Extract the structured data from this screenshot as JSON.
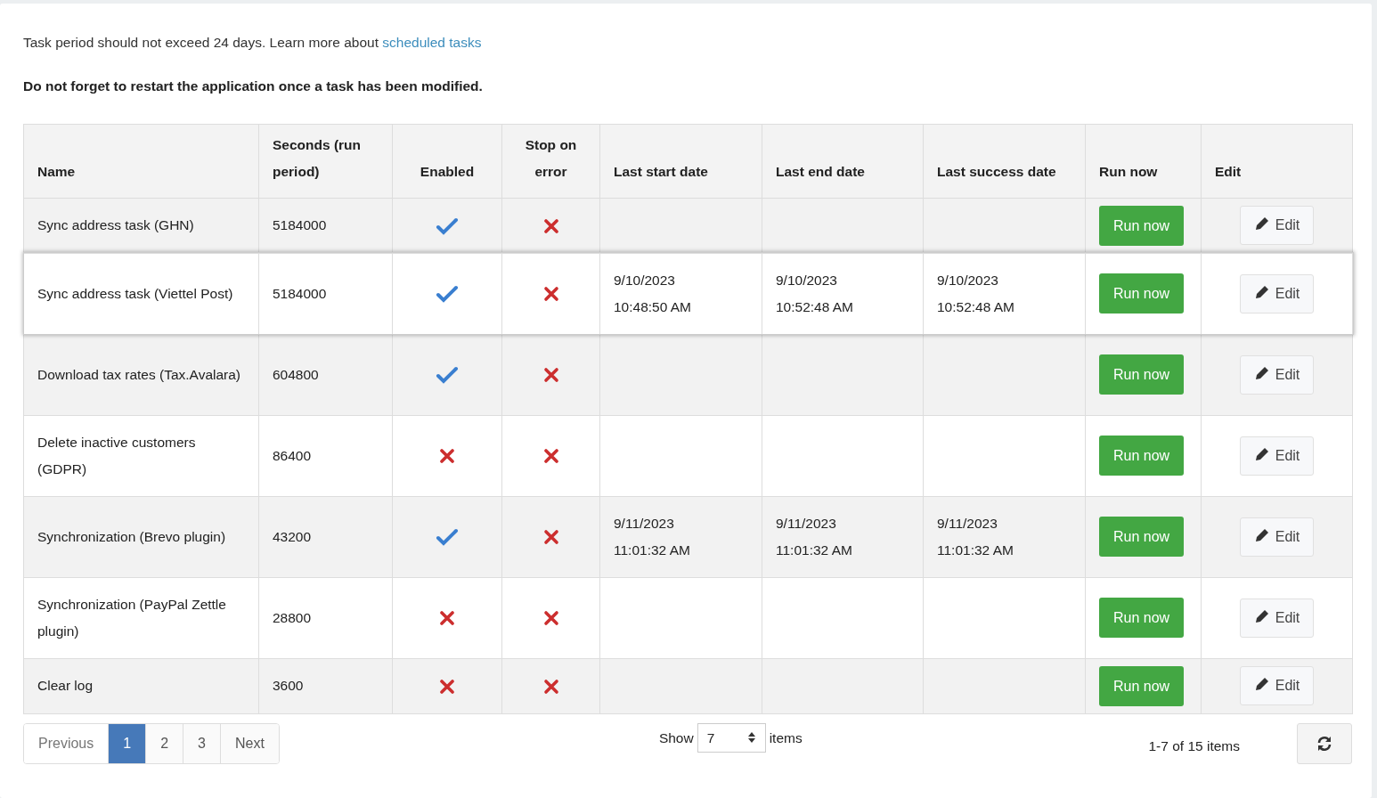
{
  "intro": {
    "text": "Task period should not exceed 24 days. Learn more about ",
    "link": "scheduled tasks"
  },
  "warning": "Do not forget to restart the application once a task has been modified.",
  "table": {
    "columns": [
      "Name",
      "Seconds (run period)",
      "Enabled",
      "Stop on error",
      "Last start date",
      "Last end date",
      "Last success date",
      "Run now",
      "Edit"
    ],
    "rows": [
      {
        "name": "Sync address task (GHN)",
        "seconds": "5184000",
        "enabled": true,
        "stop_on_error": false,
        "last_start": "",
        "last_end": "",
        "last_success": "",
        "run_label": "Run now",
        "edit_label": "Edit",
        "selected": false
      },
      {
        "name": "Sync address task (Viettel Post)",
        "seconds": "5184000",
        "enabled": true,
        "stop_on_error": false,
        "last_start": "9/10/2023 10:48:50 AM",
        "last_end": "9/10/2023 10:52:48 AM",
        "last_success": "9/10/2023 10:52:48 AM",
        "run_label": "Run now",
        "edit_label": "Edit",
        "selected": true
      },
      {
        "name": "Download tax rates (Tax.Avalara)",
        "seconds": "604800",
        "enabled": true,
        "stop_on_error": false,
        "last_start": "",
        "last_end": "",
        "last_success": "",
        "run_label": "Run now",
        "edit_label": "Edit",
        "selected": false
      },
      {
        "name": "Delete inactive customers (GDPR)",
        "seconds": "86400",
        "enabled": false,
        "stop_on_error": false,
        "last_start": "",
        "last_end": "",
        "last_success": "",
        "run_label": "Run now",
        "edit_label": "Edit",
        "selected": false
      },
      {
        "name": "Synchronization (Brevo plugin)",
        "seconds": "43200",
        "enabled": true,
        "stop_on_error": false,
        "last_start": "9/11/2023 11:01:32 AM",
        "last_end": "9/11/2023 11:01:32 AM",
        "last_success": "9/11/2023 11:01:32 AM",
        "run_label": "Run now",
        "edit_label": "Edit",
        "selected": false
      },
      {
        "name": "Synchronization (PayPal Zettle plugin)",
        "seconds": "28800",
        "enabled": false,
        "stop_on_error": false,
        "last_start": "",
        "last_end": "",
        "last_success": "",
        "run_label": "Run now",
        "edit_label": "Edit",
        "selected": false
      },
      {
        "name": "Clear log",
        "seconds": "3600",
        "enabled": false,
        "stop_on_error": false,
        "last_start": "",
        "last_end": "",
        "last_success": "",
        "run_label": "Run now",
        "edit_label": "Edit",
        "selected": false
      }
    ]
  },
  "pagination": {
    "previous": "Previous",
    "next": "Next",
    "pages": [
      {
        "label": "1",
        "selected": true
      },
      {
        "label": "2",
        "selected": false
      },
      {
        "label": "3",
        "selected": false
      }
    ]
  },
  "page_size": {
    "label": "Show",
    "value": "7",
    "suffix": "items"
  },
  "summary": "1-7 of 15 items"
}
